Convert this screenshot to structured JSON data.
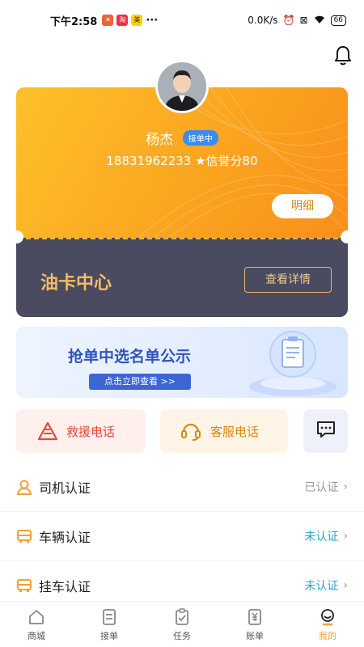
{
  "status_bar": {
    "time": "下午2:58",
    "net_speed": "0.0K/s",
    "battery": "66"
  },
  "profile": {
    "name": "杨杰",
    "badge": "接单中",
    "phone_score": "18831962233 ★信誉分80",
    "detail_label": "明细"
  },
  "oil_card": {
    "title": "油卡中心",
    "button": "查看详情"
  },
  "banner": {
    "title": "抢单中选名单公示",
    "button": "点击立即查看 >>"
  },
  "quick_actions": {
    "rescue": "救援电话",
    "service": "客服电话"
  },
  "cert_list": [
    {
      "label": "司机认证",
      "status": "已认证"
    },
    {
      "label": "车辆认证",
      "status": "未认证"
    },
    {
      "label": "挂车认证",
      "status": "未认证"
    }
  ],
  "tabs": [
    {
      "label": "商城",
      "icon": "home-icon"
    },
    {
      "label": "接单",
      "icon": "order-list-icon"
    },
    {
      "label": "任务",
      "icon": "clipboard-icon"
    },
    {
      "label": "账单",
      "icon": "bill-icon"
    },
    {
      "label": "我的",
      "icon": "profile-icon"
    }
  ],
  "colors": {
    "accent": "#f0a23a",
    "card_gold": "#fba520",
    "card_dark": "#4a4b61",
    "verified_gray": "#999999",
    "unverified_teal": "#2aa6c6"
  }
}
